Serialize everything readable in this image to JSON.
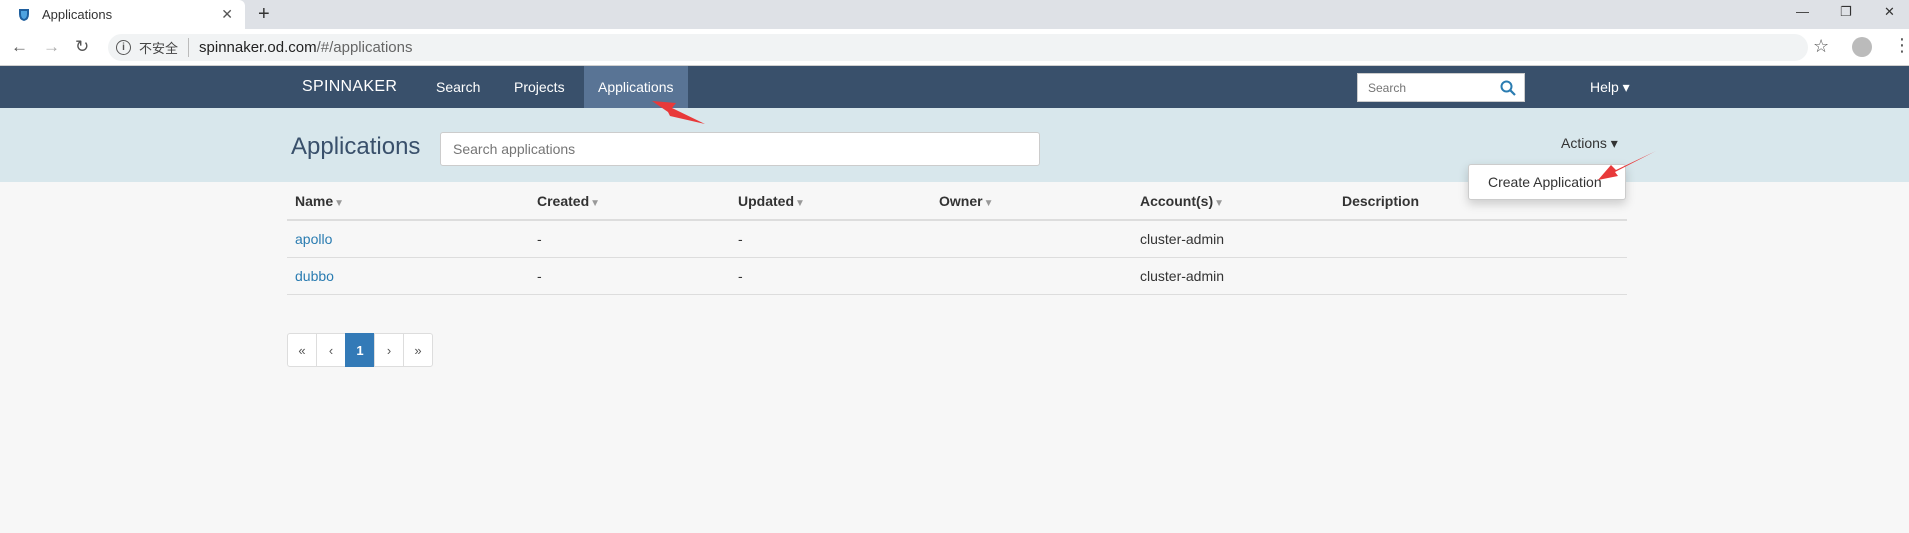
{
  "browser": {
    "tab_title": "Applications",
    "close_glyph": "✕",
    "newtab_glyph": "+",
    "insecure_label": "不安全",
    "url_host": "spinnaker.od.com",
    "url_path": "/#/applications",
    "back_glyph": "←",
    "forward_glyph": "→",
    "reload_glyph": "↻",
    "star_glyph": "☆",
    "menu_glyph": "⋮",
    "minimize_glyph": "—",
    "restore_glyph": "❐",
    "close_window_glyph": "✕"
  },
  "navbar": {
    "brand": "SPINNAKER",
    "links": [
      {
        "label": "Search",
        "active": false
      },
      {
        "label": "Projects",
        "active": false
      },
      {
        "label": "Applications",
        "active": true
      }
    ],
    "search_placeholder": "Search",
    "help_label": "Help ▾"
  },
  "header": {
    "title": "Applications",
    "search_placeholder": "Search applications",
    "actions_label": "Actions ▾",
    "dropdown_item": "Create Application"
  },
  "table": {
    "columns": [
      {
        "label": "Name",
        "sortable": true
      },
      {
        "label": "Created",
        "sortable": true
      },
      {
        "label": "Updated",
        "sortable": true
      },
      {
        "label": "Owner",
        "sortable": true
      },
      {
        "label": "Account(s)",
        "sortable": true
      },
      {
        "label": "Description",
        "sortable": false
      }
    ],
    "sort_glyph": "▼",
    "rows": [
      {
        "name": "apollo",
        "created": "-",
        "updated": "-",
        "owner": "",
        "accounts": "cluster-admin",
        "description": ""
      },
      {
        "name": "dubbo",
        "created": "-",
        "updated": "-",
        "owner": "",
        "accounts": "cluster-admin",
        "description": ""
      }
    ]
  },
  "pagination": {
    "first": "«",
    "prev": "‹",
    "current": "1",
    "next": "›",
    "last": "»"
  },
  "colors": {
    "navbar": "#39506b",
    "nav_active": "#597495",
    "header_band": "#d8e7ec",
    "link": "#2a7cb1",
    "pager_active": "#337ab7",
    "annotation_arrow": "#e8393a"
  }
}
